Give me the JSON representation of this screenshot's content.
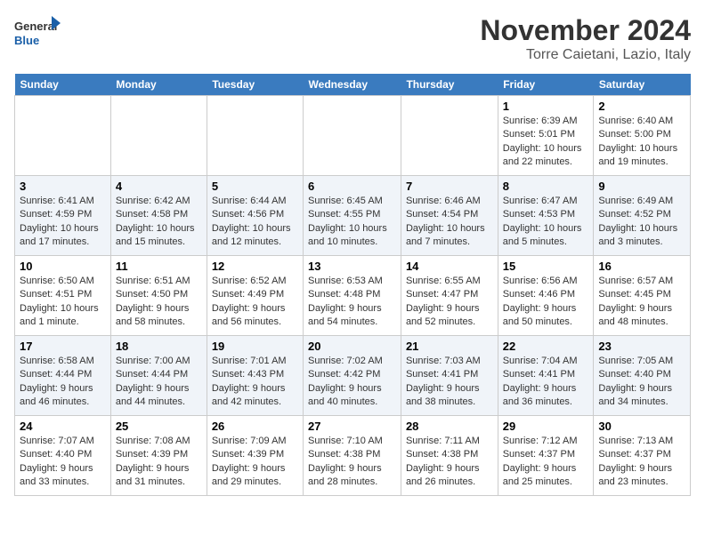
{
  "header": {
    "logo_general": "General",
    "logo_blue": "Blue",
    "month": "November 2024",
    "location": "Torre Caietani, Lazio, Italy"
  },
  "days_of_week": [
    "Sunday",
    "Monday",
    "Tuesday",
    "Wednesday",
    "Thursday",
    "Friday",
    "Saturday"
  ],
  "weeks": [
    [
      {
        "day": "",
        "info": ""
      },
      {
        "day": "",
        "info": ""
      },
      {
        "day": "",
        "info": ""
      },
      {
        "day": "",
        "info": ""
      },
      {
        "day": "",
        "info": ""
      },
      {
        "day": "1",
        "info": "Sunrise: 6:39 AM\nSunset: 5:01 PM\nDaylight: 10 hours\nand 22 minutes."
      },
      {
        "day": "2",
        "info": "Sunrise: 6:40 AM\nSunset: 5:00 PM\nDaylight: 10 hours\nand 19 minutes."
      }
    ],
    [
      {
        "day": "3",
        "info": "Sunrise: 6:41 AM\nSunset: 4:59 PM\nDaylight: 10 hours\nand 17 minutes."
      },
      {
        "day": "4",
        "info": "Sunrise: 6:42 AM\nSunset: 4:58 PM\nDaylight: 10 hours\nand 15 minutes."
      },
      {
        "day": "5",
        "info": "Sunrise: 6:44 AM\nSunset: 4:56 PM\nDaylight: 10 hours\nand 12 minutes."
      },
      {
        "day": "6",
        "info": "Sunrise: 6:45 AM\nSunset: 4:55 PM\nDaylight: 10 hours\nand 10 minutes."
      },
      {
        "day": "7",
        "info": "Sunrise: 6:46 AM\nSunset: 4:54 PM\nDaylight: 10 hours\nand 7 minutes."
      },
      {
        "day": "8",
        "info": "Sunrise: 6:47 AM\nSunset: 4:53 PM\nDaylight: 10 hours\nand 5 minutes."
      },
      {
        "day": "9",
        "info": "Sunrise: 6:49 AM\nSunset: 4:52 PM\nDaylight: 10 hours\nand 3 minutes."
      }
    ],
    [
      {
        "day": "10",
        "info": "Sunrise: 6:50 AM\nSunset: 4:51 PM\nDaylight: 10 hours\nand 1 minute."
      },
      {
        "day": "11",
        "info": "Sunrise: 6:51 AM\nSunset: 4:50 PM\nDaylight: 9 hours\nand 58 minutes."
      },
      {
        "day": "12",
        "info": "Sunrise: 6:52 AM\nSunset: 4:49 PM\nDaylight: 9 hours\nand 56 minutes."
      },
      {
        "day": "13",
        "info": "Sunrise: 6:53 AM\nSunset: 4:48 PM\nDaylight: 9 hours\nand 54 minutes."
      },
      {
        "day": "14",
        "info": "Sunrise: 6:55 AM\nSunset: 4:47 PM\nDaylight: 9 hours\nand 52 minutes."
      },
      {
        "day": "15",
        "info": "Sunrise: 6:56 AM\nSunset: 4:46 PM\nDaylight: 9 hours\nand 50 minutes."
      },
      {
        "day": "16",
        "info": "Sunrise: 6:57 AM\nSunset: 4:45 PM\nDaylight: 9 hours\nand 48 minutes."
      }
    ],
    [
      {
        "day": "17",
        "info": "Sunrise: 6:58 AM\nSunset: 4:44 PM\nDaylight: 9 hours\nand 46 minutes."
      },
      {
        "day": "18",
        "info": "Sunrise: 7:00 AM\nSunset: 4:44 PM\nDaylight: 9 hours\nand 44 minutes."
      },
      {
        "day": "19",
        "info": "Sunrise: 7:01 AM\nSunset: 4:43 PM\nDaylight: 9 hours\nand 42 minutes."
      },
      {
        "day": "20",
        "info": "Sunrise: 7:02 AM\nSunset: 4:42 PM\nDaylight: 9 hours\nand 40 minutes."
      },
      {
        "day": "21",
        "info": "Sunrise: 7:03 AM\nSunset: 4:41 PM\nDaylight: 9 hours\nand 38 minutes."
      },
      {
        "day": "22",
        "info": "Sunrise: 7:04 AM\nSunset: 4:41 PM\nDaylight: 9 hours\nand 36 minutes."
      },
      {
        "day": "23",
        "info": "Sunrise: 7:05 AM\nSunset: 4:40 PM\nDaylight: 9 hours\nand 34 minutes."
      }
    ],
    [
      {
        "day": "24",
        "info": "Sunrise: 7:07 AM\nSunset: 4:40 PM\nDaylight: 9 hours\nand 33 minutes."
      },
      {
        "day": "25",
        "info": "Sunrise: 7:08 AM\nSunset: 4:39 PM\nDaylight: 9 hours\nand 31 minutes."
      },
      {
        "day": "26",
        "info": "Sunrise: 7:09 AM\nSunset: 4:39 PM\nDaylight: 9 hours\nand 29 minutes."
      },
      {
        "day": "27",
        "info": "Sunrise: 7:10 AM\nSunset: 4:38 PM\nDaylight: 9 hours\nand 28 minutes."
      },
      {
        "day": "28",
        "info": "Sunrise: 7:11 AM\nSunset: 4:38 PM\nDaylight: 9 hours\nand 26 minutes."
      },
      {
        "day": "29",
        "info": "Sunrise: 7:12 AM\nSunset: 4:37 PM\nDaylight: 9 hours\nand 25 minutes."
      },
      {
        "day": "30",
        "info": "Sunrise: 7:13 AM\nSunset: 4:37 PM\nDaylight: 9 hours\nand 23 minutes."
      }
    ]
  ]
}
